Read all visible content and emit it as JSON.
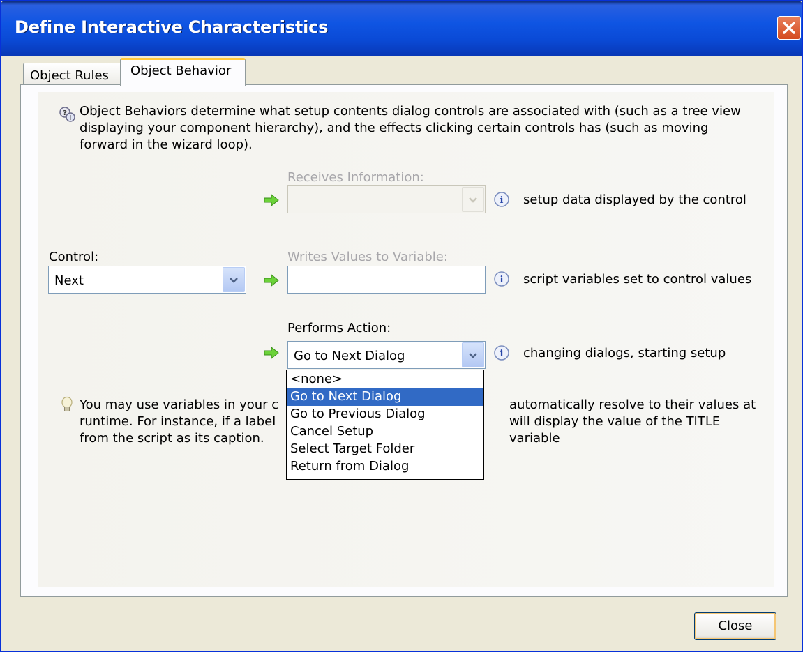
{
  "window": {
    "title": "Define Interactive Characteristics"
  },
  "tabs": [
    {
      "label": "Object Rules"
    },
    {
      "label": "Object Behavior"
    }
  ],
  "panel": {
    "intro_line1": "Object Behaviors determine what setup contents dialog controls are associated with (such as a tree view",
    "intro_line2": "displaying your component hierarchy), and the effects clicking certain controls has (such as moving",
    "intro_line3": "forward in the wizard loop).",
    "receives_label": "Receives Information:",
    "receives_value": "",
    "receives_hint": "setup data displayed by the control",
    "control_label": "Control:",
    "control_value": "Next",
    "writes_label": "Writes Values to Variable:",
    "writes_value": "",
    "writes_hint": "script variables set to control values",
    "performs_label": "Performs Action:",
    "performs_value": "Go to Next Dialog",
    "performs_hint": "changing dialogs, starting setup",
    "tip_line1a": "You may use variables in your c",
    "tip_line1b": "automatically resolve to their values at",
    "tip_line2a": "runtime. For instance, if a label",
    "tip_line2b": "will display the value of the TITLE variable",
    "tip_line3": "from the script as its caption."
  },
  "dropdown": {
    "options": [
      "<none>",
      "Go to Next Dialog",
      "Go to Previous Dialog",
      "Cancel Setup",
      "Select Target Folder",
      "Return from Dialog"
    ],
    "selected": "Go to Next Dialog"
  },
  "footer": {
    "close_label": "Close"
  },
  "colors": {
    "titlebar": "#0A4AD6",
    "selection": "#316AC5",
    "arrow": "#5BC234",
    "tab_accent": "#FFC83C"
  },
  "icons": [
    "close-icon",
    "help-icon",
    "green-arrow-icon",
    "info-icon",
    "lightbulb-icon",
    "chevron-down-icon"
  ]
}
